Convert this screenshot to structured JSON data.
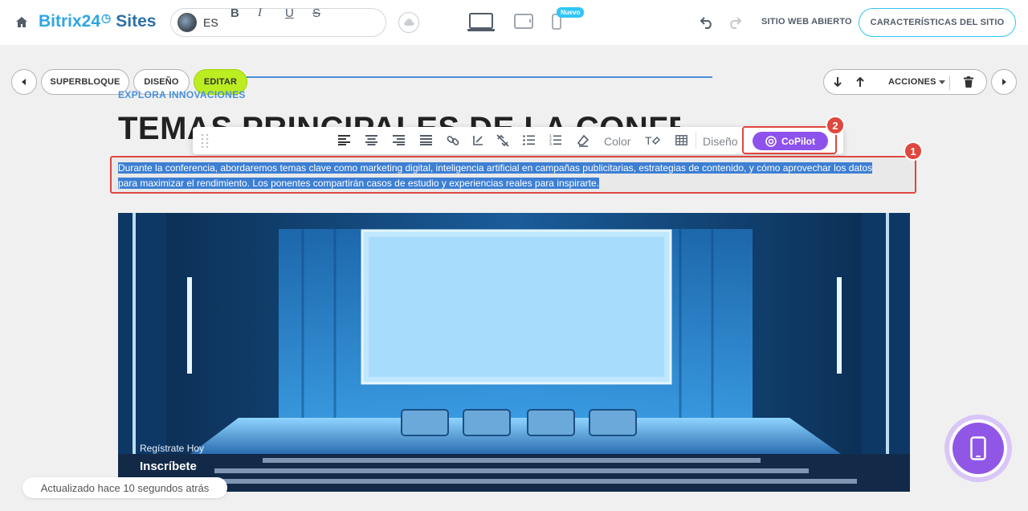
{
  "header": {
    "logo_main": "Bitrix24",
    "logo_sites": "Sites",
    "language": "ES",
    "new_badge": "Nuevo",
    "open_site_label": "SITIO WEB ABIERTO",
    "features_label": "CARACTERÍSTICAS DEL SITIO"
  },
  "block_controls": {
    "superblock_label": "SUPERBLOQUE",
    "design_label": "DISEÑO",
    "edit_label": "EDITAR",
    "actions_label": "ACCIONES"
  },
  "content": {
    "eyebrow": "EXPLORA INNOVACIONES",
    "title": "TEMAS PRINCIPALES DE LA CONFERENCIA",
    "paragraph_line1": "Durante la conferencia, abordaremos temas clave como marketing digital, inteligencia artificial en campañas publicitarias, estrategias de contenido, y cómo aprovechar los datos",
    "paragraph_line2": "para maximizar el rendimiento. Los ponentes compartirán casos de estudio y experiencias reales para inspirarte.",
    "cta_small": "Regístrate Hoy",
    "cta_main": "Inscríbete"
  },
  "toolbar": {
    "color_label": "Color",
    "design_label": "Diseño",
    "copilot_label": "CoPilot"
  },
  "annotations": {
    "badge_1": "1",
    "badge_2": "2"
  },
  "status": {
    "updated_text": "Actualizado hace 10 segundos atrás"
  },
  "colors": {
    "accent": "#2fc6f6",
    "edit_green": "#bbed21",
    "copilot_purple": "#8e52ec",
    "highlight_red": "#e0473e",
    "selection_blue": "#3d7fd3"
  }
}
